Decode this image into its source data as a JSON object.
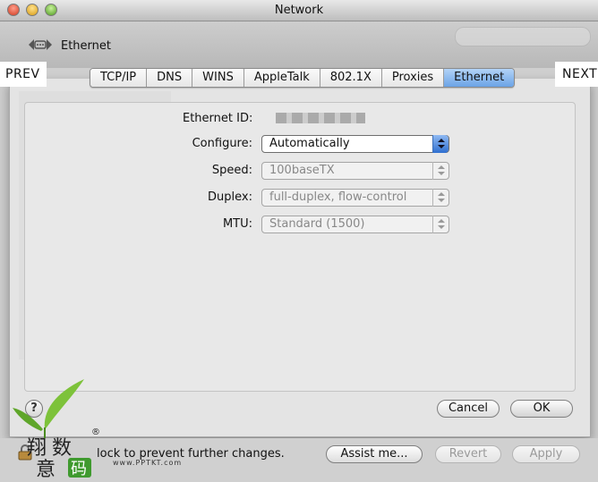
{
  "window": {
    "title": "Network"
  },
  "toolbar": {
    "location": "Ethernet"
  },
  "nav": {
    "prev": "PREV",
    "next": "NEXT"
  },
  "tabs": [
    "TCP/IP",
    "DNS",
    "WINS",
    "AppleTalk",
    "802.1X",
    "Proxies",
    "Ethernet"
  ],
  "selected_tab": "Ethernet",
  "form": {
    "ethernet_id_label": "Ethernet ID:",
    "configure_label": "Configure:",
    "configure_value": "Automatically",
    "speed_label": "Speed:",
    "speed_value": "100baseTX",
    "duplex_label": "Duplex:",
    "duplex_value": "full-duplex, flow-control",
    "mtu_label": "MTU:",
    "mtu_value": "Standard  (1500)"
  },
  "buttons": {
    "cancel": "Cancel",
    "ok": "OK",
    "assist": "Assist me...",
    "revert": "Revert",
    "apply": "Apply",
    "help": "?"
  },
  "footer": {
    "lock_text": "lock to prevent further changes."
  },
  "watermark": {
    "url": "www.PPTKT.com"
  },
  "colors": {
    "accent": "#6ba3e6",
    "default_button": "#2f6fd0"
  }
}
